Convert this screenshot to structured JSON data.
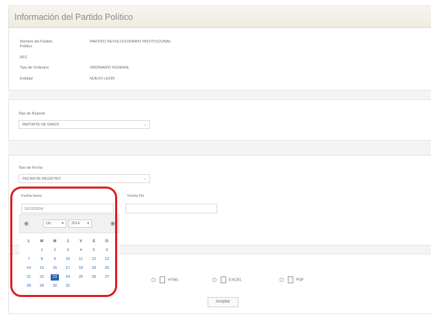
{
  "header": {
    "title": "Información del Partido Político"
  },
  "info": {
    "nombre_label": "Nombre del Partido Político",
    "nombre_value": "PARTIDO REVOLUCIONARIO INSTITUCIONAL",
    "rfc_label": "RFC",
    "rfc_value": "",
    "tipo_label": "Tipo de Ordinario",
    "tipo_value": "ORDINARIO FEDERAL",
    "entidad_label": "Entidad",
    "entidad_value": "NUEVO LEÓN"
  },
  "reporte": {
    "label": "Tipo de Reporte",
    "value": "REPORTE DE GIROS"
  },
  "fecha": {
    "label": "Tipo de Fecha",
    "value": "FECHA DE REGISTRO"
  },
  "fecha_inicio": {
    "label": "Fecha Inicio",
    "value": "01/12/2014"
  },
  "fecha_fin": {
    "label": "Fecha Fin",
    "value": ""
  },
  "calendar": {
    "prev": "◉",
    "next": "◉",
    "month": "Dic",
    "year": "2014",
    "weekdays": [
      "L",
      "M",
      "M",
      "J",
      "V",
      "S",
      "D"
    ],
    "weeks": [
      [
        "",
        "1",
        "2",
        "3",
        "4",
        "5",
        "6"
      ],
      [
        "7",
        "8",
        "9",
        "10",
        "11",
        "12",
        "13"
      ],
      [
        "14",
        "15",
        "16",
        "17",
        "18",
        "19",
        "20"
      ],
      [
        "21",
        "22",
        "23",
        "24",
        "25",
        "26",
        "27"
      ],
      [
        "28",
        "29",
        "30",
        "31",
        "",
        "",
        ""
      ]
    ],
    "selected": "23"
  },
  "export": {
    "html": "HTML",
    "excel": "EXCEL",
    "pdf": "PDF"
  },
  "submit": {
    "label": "Aceptar"
  },
  "colors": {
    "accent": "#2a62b0",
    "highlight_ring": "#e01b1b"
  }
}
